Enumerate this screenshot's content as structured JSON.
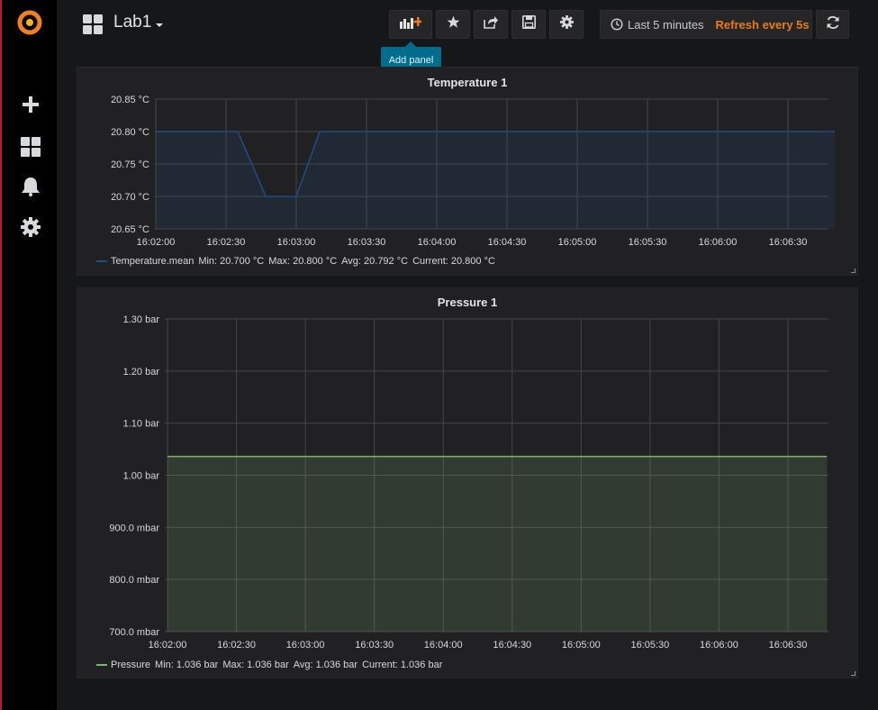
{
  "colors": {
    "accent": "#eb7b18",
    "temperature_series": "#1f4e85",
    "pressure_series": "#7eb26d",
    "tooltip": "#006d8c"
  },
  "sidebar": {
    "items": [
      {
        "icon": "plus-icon"
      },
      {
        "icon": "dashboards-icon"
      },
      {
        "icon": "bell-icon"
      },
      {
        "icon": "gear-icon"
      }
    ]
  },
  "header": {
    "dashboard_title": "Lab1",
    "add_panel_tooltip": "Add panel",
    "time_range": "Last 5 minutes",
    "refresh": "Refresh every 5s"
  },
  "panels": [
    {
      "title": "Temperature 1",
      "legend": {
        "name": "Temperature.mean",
        "min": "Min: 20.700 °C",
        "max": "Max: 20.800 °C",
        "avg": "Avg: 20.792 °C",
        "current": "Current: 20.800 °C"
      }
    },
    {
      "title": "Pressure 1",
      "legend": {
        "name": "Pressure",
        "min": "Min: 1.036 bar",
        "max": "Max: 1.036 bar",
        "avg": "Avg: 1.036 bar",
        "current": "Current: 1.036 bar"
      }
    }
  ],
  "chart_data": [
    {
      "type": "area",
      "title": "Temperature 1",
      "y_unit": "°C",
      "ylim": [
        20.65,
        20.85
      ],
      "y_ticks": [
        20.65,
        20.7,
        20.75,
        20.8,
        20.85
      ],
      "y_tick_labels": [
        "20.65 °C",
        "20.70 °C",
        "20.75 °C",
        "20.80 °C",
        "20.85 °C"
      ],
      "x_tick_labels": [
        "16:02:00",
        "16:02:30",
        "16:03:00",
        "16:03:30",
        "16:04:00",
        "16:04:30",
        "16:05:00",
        "16:05:30",
        "16:06:00",
        "16:06:30"
      ],
      "x_ticks_seconds": [
        0,
        30,
        60,
        90,
        120,
        150,
        180,
        210,
        240,
        270
      ],
      "xlim_seconds": [
        0,
        290
      ],
      "grid": true,
      "series": [
        {
          "name": "Temperature.mean",
          "x_seconds": [
            0,
            35,
            47,
            60,
            70,
            290
          ],
          "values": [
            20.8,
            20.8,
            20.7,
            20.7,
            20.8,
            20.8
          ]
        }
      ]
    },
    {
      "type": "area",
      "title": "Pressure 1",
      "ylim": [
        0.7,
        1.3
      ],
      "y_ticks": [
        0.7,
        0.8,
        0.9,
        1.0,
        1.1,
        1.2,
        1.3
      ],
      "y_tick_labels": [
        "700.0 mbar",
        "800.0 mbar",
        "900.0 mbar",
        "1.00 bar",
        "1.10 bar",
        "1.20 bar",
        "1.30 bar"
      ],
      "x_tick_labels": [
        "16:02:00",
        "16:02:30",
        "16:03:00",
        "16:03:30",
        "16:04:00",
        "16:04:30",
        "16:05:00",
        "16:05:30",
        "16:06:00",
        "16:06:30"
      ],
      "x_ticks_seconds": [
        0,
        30,
        60,
        90,
        120,
        150,
        180,
        210,
        240,
        270
      ],
      "xlim_seconds": [
        0,
        287
      ],
      "grid": true,
      "series": [
        {
          "name": "Pressure",
          "x_seconds": [
            0,
            287
          ],
          "values": [
            1.036,
            1.036
          ]
        }
      ]
    }
  ]
}
